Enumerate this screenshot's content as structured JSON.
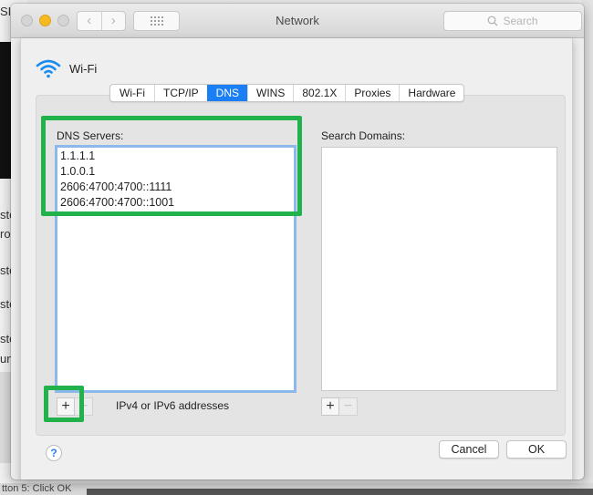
{
  "window": {
    "title": "Network",
    "search_placeholder": "Search",
    "nav_back": "‹",
    "nav_forward": "›"
  },
  "interface": {
    "icon": "wifi-icon",
    "name": "Wi-Fi"
  },
  "tabs": [
    {
      "label": "Wi-Fi",
      "active": false
    },
    {
      "label": "TCP/IP",
      "active": false
    },
    {
      "label": "DNS",
      "active": true
    },
    {
      "label": "WINS",
      "active": false
    },
    {
      "label": "802.1X",
      "active": false
    },
    {
      "label": "Proxies",
      "active": false
    },
    {
      "label": "Hardware",
      "active": false
    }
  ],
  "dns": {
    "label": "DNS Servers:",
    "servers": [
      "1.1.1.1",
      "1.0.0.1",
      "2606:4700:4700::1111",
      "2606:4700:4700::1001"
    ],
    "add_label": "+",
    "remove_label": "−",
    "hint": "IPv4 or IPv6 addresses"
  },
  "search_domains": {
    "label": "Search Domains:",
    "domains": [],
    "add_label": "+",
    "remove_label": "−"
  },
  "footer": {
    "help_label": "?",
    "cancel_label": "Cancel",
    "ok_label": "OK"
  },
  "annotations": {
    "highlight_color": "#22b24c"
  },
  "background_fragments": [
    "SI",
    "ste",
    "ro",
    "ste",
    "ste",
    "ste",
    "un",
    "tton 5: Click OK"
  ]
}
